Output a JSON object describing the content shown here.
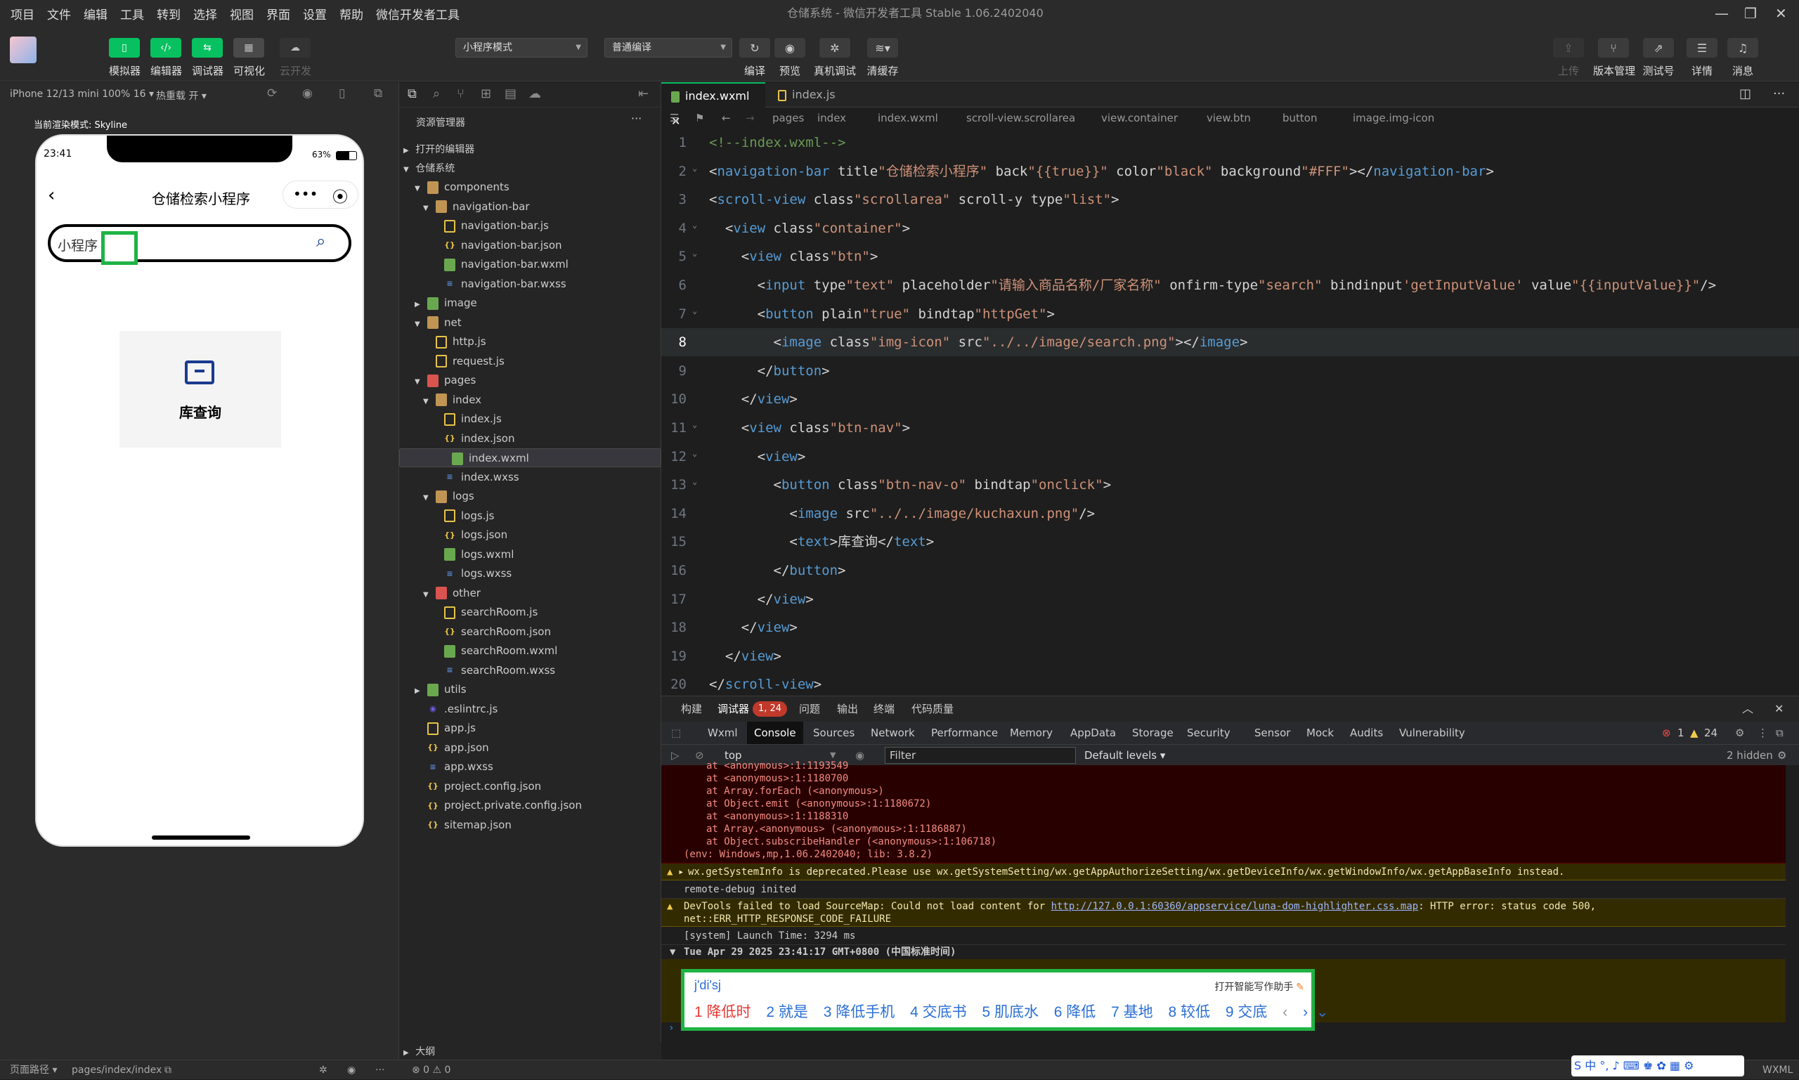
{
  "menu": {
    "items": [
      "项目",
      "文件",
      "编辑",
      "工具",
      "转到",
      "选择",
      "视图",
      "界面",
      "设置",
      "帮助",
      "微信开发者工具"
    ],
    "window_title": "仓储系统 - 微信开发者工具 Stable 1.06.2402040"
  },
  "toolbar": {
    "left_buttons": [
      {
        "label": "模拟器",
        "icon": "phone-icon"
      },
      {
        "label": "编辑器",
        "icon": "code-icon"
      },
      {
        "label": "调试器",
        "icon": "debug-icon"
      },
      {
        "label": "可视化",
        "icon": "layout-icon"
      },
      {
        "label": "云开发",
        "icon": "cloud-icon"
      }
    ],
    "mode_select": "小程序模式",
    "compile_select": "普通编译",
    "mid_buttons": [
      "编译",
      "预览",
      "真机调试",
      "清缓存"
    ],
    "right_buttons": [
      "上传",
      "版本管理",
      "测试号",
      "详情",
      "消息"
    ]
  },
  "simulator": {
    "device": "iPhone 12/13 mini 100% 16",
    "hotreload": "热重载 开",
    "render_mode": "当前渲染模式: Skyline",
    "status_time": "23:41",
    "battery": "63%",
    "nav_title": "仓储检索小程序",
    "search_text": "小程序",
    "nav_card_label": "库查询"
  },
  "explorer": {
    "title": "资源管理器",
    "open_editors": "打开的编辑器",
    "project": "仓储系统",
    "outline": "大纲",
    "tree": [
      {
        "name": "components",
        "type": "folder",
        "depth": 1
      },
      {
        "name": "navigation-bar",
        "type": "folder",
        "depth": 2
      },
      {
        "name": "navigation-bar.js",
        "type": "js",
        "depth": 3
      },
      {
        "name": "navigation-bar.json",
        "type": "json",
        "depth": 3
      },
      {
        "name": "navigation-bar.wxml",
        "type": "wxml",
        "depth": 3
      },
      {
        "name": "navigation-bar.wxss",
        "type": "wxss",
        "depth": 3
      },
      {
        "name": "image",
        "type": "folder-green",
        "depth": 1
      },
      {
        "name": "net",
        "type": "folder",
        "depth": 1
      },
      {
        "name": "http.js",
        "type": "js",
        "depth": 2
      },
      {
        "name": "request.js",
        "type": "js",
        "depth": 2
      },
      {
        "name": "pages",
        "type": "folder-red",
        "depth": 1
      },
      {
        "name": "index",
        "type": "folder",
        "depth": 2
      },
      {
        "name": "index.js",
        "type": "js",
        "depth": 3
      },
      {
        "name": "index.json",
        "type": "json",
        "depth": 3
      },
      {
        "name": "index.wxml",
        "type": "wxml",
        "depth": 3,
        "selected": true
      },
      {
        "name": "index.wxss",
        "type": "wxss",
        "depth": 3
      },
      {
        "name": "logs",
        "type": "folder",
        "depth": 2
      },
      {
        "name": "logs.js",
        "type": "js",
        "depth": 3
      },
      {
        "name": "logs.json",
        "type": "json",
        "depth": 3
      },
      {
        "name": "logs.wxml",
        "type": "wxml",
        "depth": 3
      },
      {
        "name": "logs.wxss",
        "type": "wxss",
        "depth": 3
      },
      {
        "name": "other",
        "type": "folder-red",
        "depth": 2
      },
      {
        "name": "searchRoom.js",
        "type": "js",
        "depth": 3
      },
      {
        "name": "searchRoom.json",
        "type": "json",
        "depth": 3
      },
      {
        "name": "searchRoom.wxml",
        "type": "wxml",
        "depth": 3
      },
      {
        "name": "searchRoom.wxss",
        "type": "wxss",
        "depth": 3
      },
      {
        "name": "utils",
        "type": "folder-green",
        "depth": 1
      },
      {
        "name": ".eslintrc.js",
        "type": "eslint",
        "depth": 1
      },
      {
        "name": "app.js",
        "type": "js",
        "depth": 1
      },
      {
        "name": "app.json",
        "type": "json",
        "depth": 1
      },
      {
        "name": "app.wxss",
        "type": "wxss",
        "depth": 1
      },
      {
        "name": "project.config.json",
        "type": "json",
        "depth": 1
      },
      {
        "name": "project.private.config.json",
        "type": "json",
        "depth": 1
      },
      {
        "name": "sitemap.json",
        "type": "json",
        "depth": 1
      }
    ]
  },
  "editor": {
    "tabs": [
      "index.wxml",
      "index.js"
    ],
    "breadcrumb": [
      "pages",
      "index",
      "index.wxml",
      "scroll-view.scrollarea",
      "view.container",
      "view.btn",
      "button",
      "image.img-icon"
    ],
    "lines": [
      "<!--index.wxml-->",
      "<navigation-bar title=\"仓储检索小程序\" back=\"{{true}}\" color=\"black\" background=\"#FFF\"></navigation-bar>",
      "<scroll-view class=\"scrollarea\" scroll-y type=\"list\">",
      "  <view class=\"container\">",
      "    <view class=\"btn\">",
      "      <input type=\"text\" placeholder=\"请输入商品名称/厂家名称\" onfirm-type=\"search\" bindinput='getInputValue' value=\"{{inputValue}}\"/>",
      "      <button plain=\"true\" bindtap=\"httpGet\">",
      "        <image class=\"img-icon\" src=\"../../image/search.png\"></image>",
      "      </button>",
      "    </view>",
      "    <view class=\"btn-nav\">",
      "      <view>",
      "        <button class=\"btn-nav-o\" bindtap=\"onclick\">",
      "          <image src=\"../../image/kuchaxun.png\"/>",
      "          <text>库查询</text>",
      "        </button>",
      "      </view>",
      "    </view>",
      "  </view>",
      "</scroll-view>"
    ]
  },
  "console": {
    "panel_tabs": [
      "构建",
      "调试器",
      "问题",
      "输出",
      "终端",
      "代码质量"
    ],
    "badge": "1, 24",
    "devtools_tabs": [
      "Wxml",
      "Console",
      "Sources",
      "Network",
      "Performance",
      "Memory",
      "AppData",
      "Storage",
      "Security",
      "Sensor",
      "Mock",
      "Audits",
      "Vulnerability"
    ],
    "error_count": "1",
    "warn_count": "24",
    "context": "top",
    "filter_placeholder": "Filter",
    "levels": "Default levels",
    "hidden": "2 hidden",
    "stack": [
      "at <anonymous>:1:1193549",
      "at <anonymous>:1:1180700",
      "at Array.forEach (<anonymous>)",
      "at Object.emit (<anonymous>:1:1180672)",
      "at <anonymous>:1:1188310",
      "at Array.<anonymous> (<anonymous>:1:1186887)",
      "at Object.subscribeHandler (<anonymous>:1:106718)"
    ],
    "env_line": "(env: Windows,mp,1.06.2402040; lib: 3.8.2)",
    "warn1": "wx.getSystemInfo is deprecated.Please use wx.getSystemSetting/wx.getAppAuthorizeSetting/wx.getDeviceInfo/wx.getWindowInfo/wx.getAppBaseInfo instead.",
    "remote": "remote-debug inited",
    "warn2a": "DevTools failed to load SourceMap: Could not load content for ",
    "warn2link": "http://127.0.0.1:60360/appservice/luna-dom-highlighter.css.map",
    "warn2b": ": HTTP error: status code 500,",
    "warn2c": "net::ERR_HTTP_RESPONSE_CODE_FAILURE",
    "launch": "[system] Launch Time: 3294 ms",
    "date_group": "Tue Apr 29 2025 23:41:17 GMT+0800 (中国标准时间)"
  },
  "ime": {
    "composition": "j'di'sj",
    "assistant": "打开智能写作助手",
    "candidates": [
      "1 降低时",
      "2 就是",
      "3 降低手机",
      "4 交底书",
      "5 肌底水",
      "6 降低",
      "7 基地",
      "8 较低",
      "9 交底"
    ]
  },
  "statusbar": {
    "path_label": "页面路径",
    "path": "pages/index/index",
    "counts": "⊗ 0 ⚠ 0",
    "lang": "WXML"
  },
  "tray": "S 中 °, ♪ ⌨ ♚ ✿ ▦ ⚙"
}
